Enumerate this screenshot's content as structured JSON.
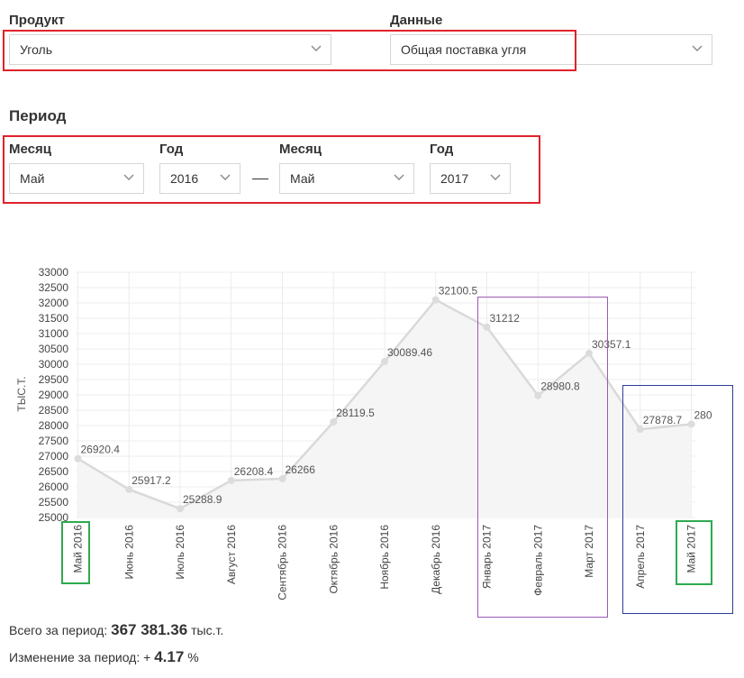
{
  "filters": {
    "product_label": "Продукт",
    "product_value": "Уголь",
    "data_label": "Данные",
    "data_value": "Общая поставка угля"
  },
  "period": {
    "title": "Период",
    "from_month_label": "Месяц",
    "from_month_value": "Май",
    "from_year_label": "Год",
    "from_year_value": "2016",
    "separator": "—",
    "to_month_label": "Месяц",
    "to_month_value": "Май",
    "to_year_label": "Год",
    "to_year_value": "2017"
  },
  "icons": {
    "dropdown": "chevron-down-icon"
  },
  "colors": {
    "highlight_red": "#e0222b",
    "highlight_purple": "#9b59b6",
    "highlight_blue": "#2c3e9a",
    "highlight_green": "#2eaa4f",
    "series_line": "#d9d9d9"
  },
  "chart_data": {
    "type": "area",
    "ylabel": "ТЫС.Т.",
    "ylim": [
      25000,
      33000
    ],
    "ytick_step": 500,
    "grid": true,
    "categories": [
      "Май 2016",
      "Июнь 2016",
      "Июль 2016",
      "Август 2016",
      "Сентябрь 2016",
      "Октябрь 2016",
      "Ноябрь 2016",
      "Декабрь 2016",
      "Январь 2017",
      "Февраль 2017",
      "Март 2017",
      "Апрель 2017",
      "Май 2017"
    ],
    "values": [
      26920.4,
      25917.2,
      25288.9,
      26208.4,
      26266,
      28119.5,
      30089.46,
      32100.5,
      31212,
      28980.8,
      30357.1,
      27878.7,
      28044.9
    ],
    "data_labels": [
      "26920.4",
      "25917.2",
      "25288.9",
      "26208.4",
      "26266",
      "28119.5",
      "30089.46",
      "32100.5",
      "31212",
      "28980.8",
      "30357.1",
      "27878.7",
      "280"
    ]
  },
  "summary": {
    "total_label": "Всего за период:",
    "total_value": "367 381.36",
    "total_unit": "тыс.т.",
    "change_label": "Изменение за период:",
    "change_sign": "+",
    "change_value": "4.17",
    "change_unit": "%"
  }
}
